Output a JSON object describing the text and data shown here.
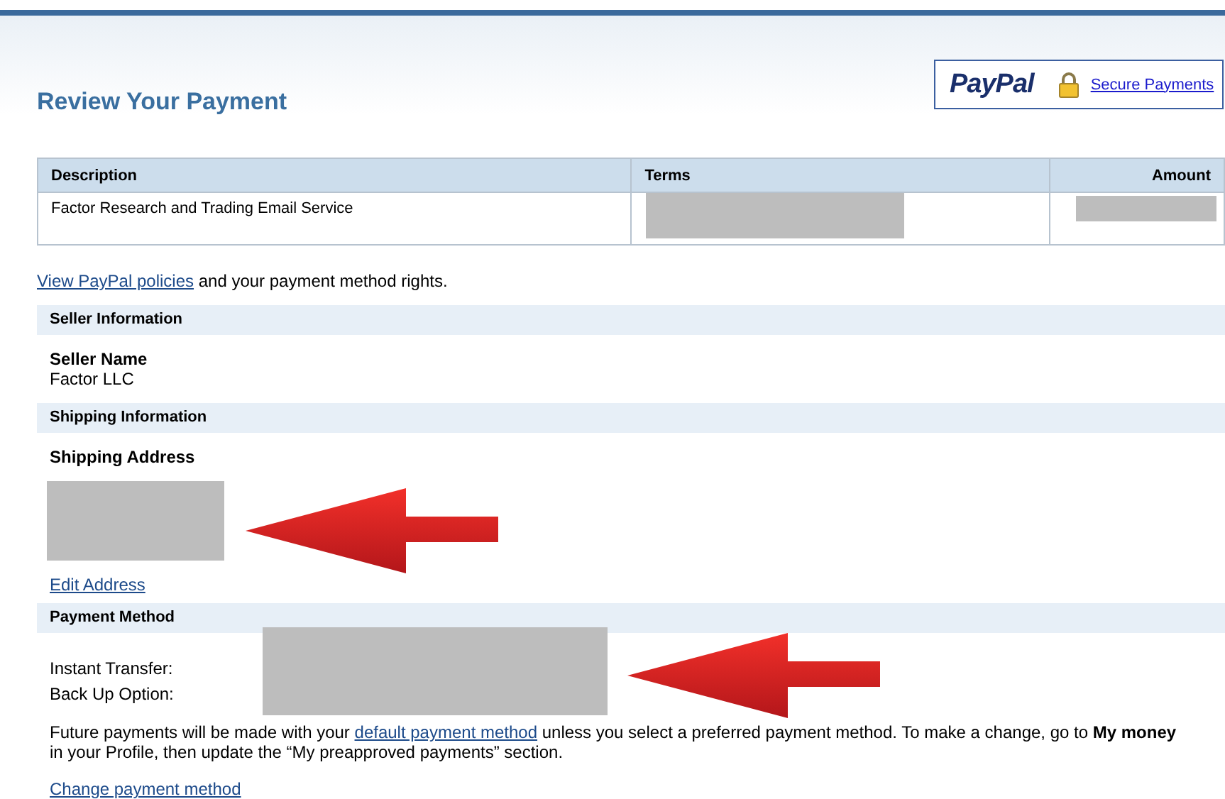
{
  "header": {
    "title": "Review Your Payment",
    "logo": "PayPal",
    "secure_link": "Secure Payments"
  },
  "table": {
    "columns": [
      "Description",
      "Terms",
      "Amount"
    ],
    "rows": [
      {
        "description": "Factor Research and Trading Email Service"
      }
    ]
  },
  "policies": {
    "link": "View PayPal policies",
    "text": " and your payment method rights."
  },
  "seller": {
    "heading": "Seller Information",
    "label": "Seller Name",
    "value": "Factor LLC"
  },
  "shipping": {
    "heading": "Shipping Information",
    "label": "Shipping Address",
    "edit_link": "Edit Address"
  },
  "payment": {
    "heading": "Payment Method",
    "labels": [
      "Instant Transfer:",
      "Back Up Option:"
    ],
    "note_before": "Future payments will be made with your ",
    "note_link": "default payment method",
    "note_after": " unless you select a preferred payment method. To make a change, go to **My money** in your Profile, then update the “My preapproved payments” section.",
    "change_link": "Change payment method"
  }
}
